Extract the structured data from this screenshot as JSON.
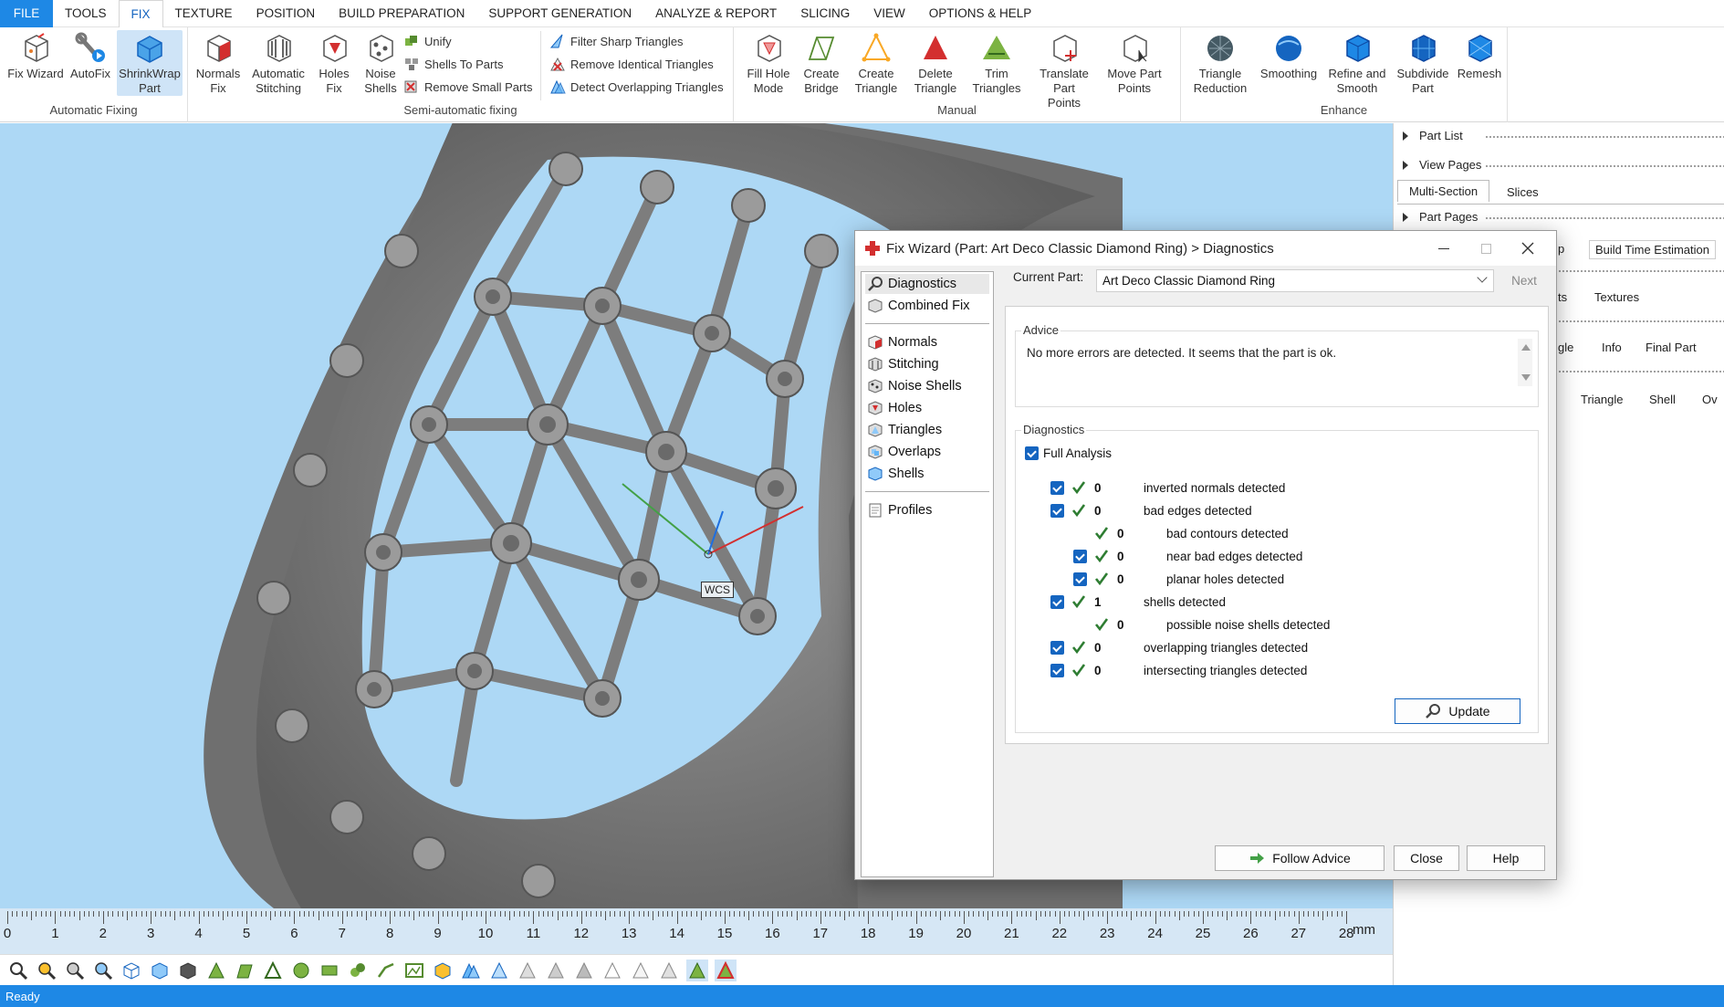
{
  "menubar": {
    "items": [
      "FILE",
      "TOOLS",
      "FIX",
      "TEXTURE",
      "POSITION",
      "BUILD PREPARATION",
      "SUPPORT GENERATION",
      "ANALYZE & REPORT",
      "SLICING",
      "VIEW",
      "OPTIONS & HELP"
    ],
    "active": "FIX"
  },
  "ribbon": {
    "groups": {
      "automatic": "Automatic Fixing",
      "semi": "Semi-automatic fixing",
      "manual": "Manual",
      "enhance": "Enhance"
    },
    "fix_wizard": "Fix Wizard",
    "autofix": "AutoFix",
    "shrinkwrap_1": "ShrinkWrap",
    "shrinkwrap_2": "Part",
    "normals_1": "Normals",
    "normals_2": "Fix",
    "stitching_1": "Automatic",
    "stitching_2": "Stitching",
    "holes_1": "Holes",
    "holes_2": "Fix",
    "noise_1": "Noise",
    "noise_2": "Shells",
    "unify": "Unify",
    "shells_to_parts": "Shells To Parts",
    "remove_small": "Remove Small Parts",
    "filter_sharp": "Filter Sharp Triangles",
    "remove_identical": "Remove Identical Triangles",
    "detect_overlap": "Detect Overlapping Triangles",
    "fill_hole_1": "Fill Hole",
    "fill_hole_2": "Mode",
    "create_bridge_1": "Create",
    "create_bridge_2": "Bridge",
    "create_tri_1": "Create",
    "create_tri_2": "Triangle",
    "delete_tri_1": "Delete",
    "delete_tri_2": "Triangle",
    "trim_1": "Trim",
    "trim_2": "Triangles",
    "translate_1": "Translate Part",
    "translate_2": "Points",
    "move_1": "Move Part",
    "move_2": "Points",
    "reduction_1": "Triangle",
    "reduction_2": "Reduction",
    "smoothing": "Smoothing",
    "refine_1": "Refine and",
    "refine_2": "Smooth",
    "subdivide_1": "Subdivide",
    "subdivide_2": "Part",
    "remesh": "Remesh"
  },
  "viewport": {
    "wcs_label": "WCS",
    "ruler_unit": "mm",
    "ruler_numbers": [
      "0",
      "1",
      "2",
      "3",
      "4",
      "5",
      "6",
      "7",
      "8",
      "9",
      "10",
      "11",
      "12",
      "13",
      "14",
      "15",
      "16",
      "17",
      "18",
      "19",
      "20",
      "21",
      "22",
      "23",
      "24",
      "25",
      "26",
      "27",
      "28"
    ]
  },
  "rightpanel": {
    "part_list": "Part List",
    "view_pages": "View Pages",
    "tab_multisection": "Multi-Section",
    "tab_slices": "Slices",
    "part_pages": "Part Pages",
    "frag_p": "p",
    "build_time": "Build Time Estimation",
    "frag_ts": "ts",
    "textures": "Textures",
    "frag_gle": "gle",
    "info": "Info",
    "final_part": "Final Part",
    "col_triangle": "Triangle",
    "col_shell": "Shell",
    "col_ov": "Ov"
  },
  "dialog": {
    "title": "Fix Wizard (Part: Art Deco Classic  Diamond Ring) > Diagnostics",
    "nav_top": [
      "Diagnostics",
      "Combined Fix"
    ],
    "nav_mid": [
      "Normals",
      "Stitching",
      "Noise Shells",
      "Holes",
      "Triangles",
      "Overlaps",
      "Shells"
    ],
    "nav_bottom": [
      "Profiles"
    ],
    "current_part_label": "Current Part:",
    "current_part_value": "Art Deco Classic  Diamond Ring",
    "next": "Next",
    "advice_legend": "Advice",
    "advice_text": "No more errors are detected. It seems that the part is ok.",
    "diag_legend": "Diagnostics",
    "full_analysis": "Full Analysis",
    "rows": [
      {
        "num": "0",
        "text": "inverted normals detected",
        "checkbox": true
      },
      {
        "num": "0",
        "text": "bad edges detected",
        "checkbox": true
      },
      {
        "num": "0",
        "text": "bad contours detected",
        "checkbox": false
      },
      {
        "num": "0",
        "text": "near bad edges detected",
        "checkbox": true
      },
      {
        "num": "0",
        "text": "planar holes detected",
        "checkbox": true
      },
      {
        "num": "1",
        "text": "shells detected",
        "checkbox": true
      },
      {
        "num": "0",
        "text": "possible noise shells detected",
        "checkbox": false
      },
      {
        "num": "0",
        "text": "overlapping triangles detected",
        "checkbox": true
      },
      {
        "num": "0",
        "text": "intersecting triangles detected",
        "checkbox": true
      }
    ],
    "update": "Update",
    "follow_advice": "Follow Advice",
    "close": "Close",
    "help": "Help"
  },
  "status": {
    "text": "Ready"
  },
  "colors": {
    "accent": "#1e88e5",
    "viewport_bg": "#add8f5",
    "model": "#8a8a8a"
  }
}
